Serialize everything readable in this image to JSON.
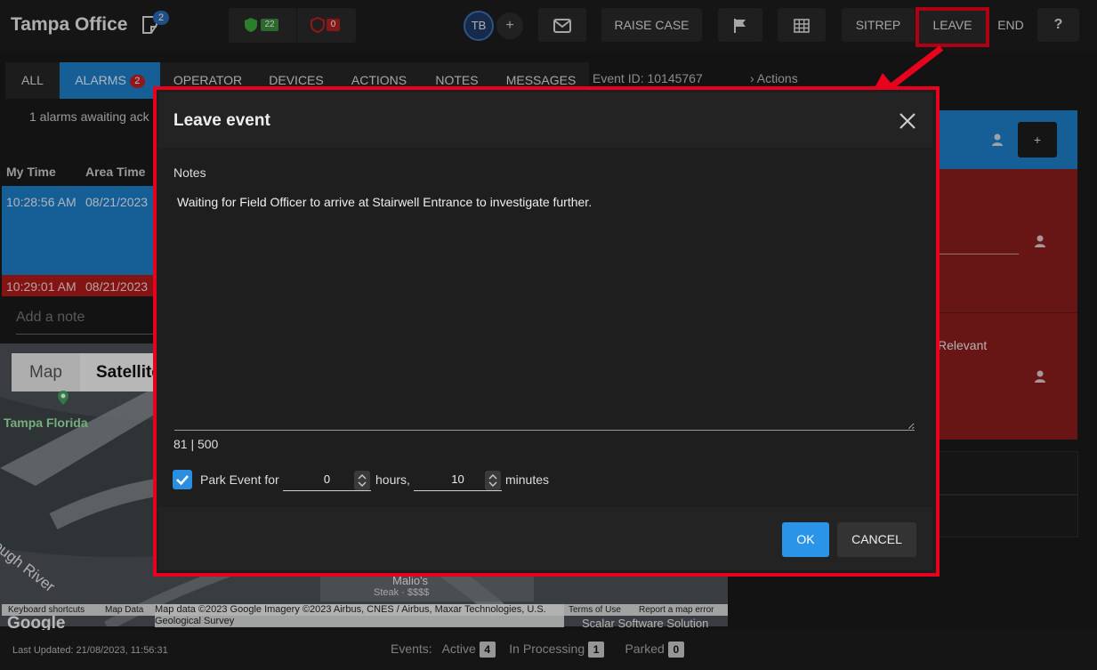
{
  "app": {
    "title": "Tampa Office",
    "notes_badge": "2",
    "status_green_count": "22",
    "status_red_count": "0",
    "user_initials": "TB",
    "add_label": "+"
  },
  "toolbar": {
    "raise_case": "RAISE CASE",
    "sitrep": "SITREP",
    "leave": "LEAVE",
    "end": "END",
    "help": "?"
  },
  "tabs": [
    {
      "label": "ALL"
    },
    {
      "label": "ALARMS",
      "badge": "2"
    },
    {
      "label": "OPERATOR"
    },
    {
      "label": "DEVICES"
    },
    {
      "label": "ACTIONS"
    },
    {
      "label": "NOTES"
    },
    {
      "label": "MESSAGES"
    }
  ],
  "event_id": "Event ID: 10145767",
  "actions_link": "Actions",
  "alarms_waiting": "1 alarms awaiting ack",
  "table": {
    "col_my_time": "My Time",
    "col_area_time": "Area Time",
    "rows": [
      {
        "my_time": "10:28:56 AM",
        "area_time": "08/21/2023"
      },
      {
        "my_time": "10:29:01 AM",
        "area_time": "08/21/2023"
      }
    ]
  },
  "add_note_placeholder": "Add a note",
  "map": {
    "btn_map": "Map",
    "btn_satellite": "Satellite",
    "place_tampa": "Tampa Florida",
    "place_river": "rough River",
    "place_malio": "Malio's",
    "place_malio_sub": "Steak · $$$$",
    "place_scalar": "Scalar Software Solution",
    "keyboard": "Keyboard shortcuts",
    "mapdata": "Map Data",
    "attribution": "Map data ©2023 Google Imagery ©2023 Airbus, CNES / Airbus, Maxar Technologies, U.S. Geological Survey",
    "terms": "Terms of Use",
    "report": "Report a map error",
    "google": "Google"
  },
  "right_panel": {
    "relevant_text": "Relevant",
    "plus": "+"
  },
  "modal": {
    "title": "Leave event",
    "notes_label": "Notes",
    "notes_value": "Waiting for Field Officer to arrive at Stairwell Entrance to investigate further.",
    "counter": "81 | 500",
    "park_label": "Park Event for",
    "hours_value": "0",
    "hours_label": "hours,",
    "minutes_value": "10",
    "minutes_label": "minutes",
    "ok": "OK",
    "cancel": "CANCEL"
  },
  "footer": {
    "last_updated": "Last Updated: 21/08/2023, 11:56:31",
    "events_label": "Events:",
    "active_label": "Active",
    "active_count": "4",
    "processing_label": "In Processing",
    "processing_count": "1",
    "parked_label": "Parked",
    "parked_count": "0"
  },
  "colors": {
    "accent_blue": "#1e7ec8",
    "alarm_red": "#8a1c1c",
    "highlight_red": "#e8001c"
  }
}
